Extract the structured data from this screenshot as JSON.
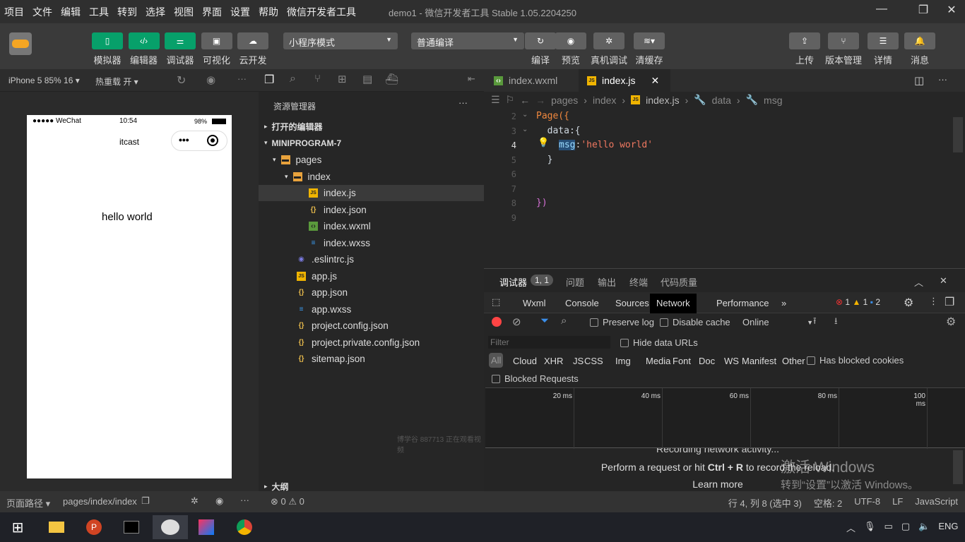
{
  "menu": [
    "项目",
    "文件",
    "编辑",
    "工具",
    "转到",
    "选择",
    "视图",
    "界面",
    "设置",
    "帮助",
    "微信开发者工具"
  ],
  "window_title": "demo1 - 微信开发者工具 Stable 1.05.2204250",
  "toolbar": {
    "left": [
      {
        "label": "模拟器",
        "icon": "phone-icon",
        "active": true
      },
      {
        "label": "编辑器",
        "icon": "code-icon",
        "active": true
      },
      {
        "label": "调试器",
        "icon": "debug-icon",
        "active": true
      },
      {
        "label": "可视化",
        "icon": "layout-icon",
        "active": false
      },
      {
        "label": "云开发",
        "icon": "cloud-icon",
        "active": false
      }
    ],
    "mode_select": "小程序模式",
    "compile_select": "普通编译",
    "middle": [
      {
        "label": "编译",
        "icon": "refresh-icon"
      },
      {
        "label": "预览",
        "icon": "eye-icon"
      },
      {
        "label": "真机调试",
        "icon": "bug-icon"
      },
      {
        "label": "清缓存",
        "icon": "layers-icon"
      }
    ],
    "right": [
      {
        "label": "上传",
        "icon": "upload-icon"
      },
      {
        "label": "版本管理",
        "icon": "branch-icon"
      },
      {
        "label": "详情",
        "icon": "menu-icon"
      },
      {
        "label": "消息",
        "icon": "bell-icon"
      }
    ]
  },
  "sim": {
    "device": "iPhone 5 85% 16 ▾",
    "hot_reload": "热重载 开 ▾",
    "carrier": "●●●●● WeChat",
    "time": "10:54",
    "battery": "98%",
    "nav_title": "itcast",
    "content": "hello world",
    "path_label": "页面路径 ▾",
    "path": "pages/index/index"
  },
  "explorer": {
    "title": "资源管理器",
    "open_editors": "打开的编辑器",
    "project": "MINIPROGRAM-7",
    "outline": "大纲",
    "files": [
      {
        "name": "pages",
        "indent": 1,
        "icon": "folder-icon",
        "tw": "▾"
      },
      {
        "name": "index",
        "indent": 2,
        "icon": "folder-icon",
        "tw": "▾"
      },
      {
        "name": "index.js",
        "indent": 3,
        "icon": "js-icon",
        "selected": true
      },
      {
        "name": "index.json",
        "indent": 3,
        "icon": "json-icon"
      },
      {
        "name": "index.wxml",
        "indent": 3,
        "icon": "wxml-icon"
      },
      {
        "name": "index.wxss",
        "indent": 3,
        "icon": "css-icon"
      },
      {
        "name": ".eslintrc.js",
        "indent": 2,
        "icon": "eslint-icon"
      },
      {
        "name": "app.js",
        "indent": 2,
        "icon": "js-icon"
      },
      {
        "name": "app.json",
        "indent": 2,
        "icon": "json-icon"
      },
      {
        "name": "app.wxss",
        "indent": 2,
        "icon": "css-icon"
      },
      {
        "name": "project.config.json",
        "indent": 2,
        "icon": "json-icon"
      },
      {
        "name": "project.private.config.json",
        "indent": 2,
        "icon": "json-icon"
      },
      {
        "name": "sitemap.json",
        "indent": 2,
        "icon": "json-icon"
      }
    ],
    "watermark": "博学谷 887713 正在观看视频"
  },
  "editor": {
    "tabs": [
      {
        "name": "index.wxml"
      },
      {
        "name": "index.js",
        "active": true
      }
    ],
    "breadcrumb": [
      "pages",
      "index",
      "index.js",
      "data",
      "msg"
    ],
    "lines": [
      {
        "n": "2",
        "t": "Page({"
      },
      {
        "n": "3",
        "t": "  data:{"
      },
      {
        "n": "4",
        "k": "msg",
        "v": "'hello world'"
      },
      {
        "n": "5",
        "t": "  }"
      },
      {
        "n": "6",
        "t": ""
      },
      {
        "n": "7",
        "t": ""
      },
      {
        "n": "8",
        "t": "})"
      },
      {
        "n": "9",
        "t": ""
      }
    ]
  },
  "debug": {
    "tabs": [
      "调试器",
      "问题",
      "输出",
      "终端",
      "代码质量"
    ],
    "badge": "1, 1",
    "devtabs": [
      "Wxml",
      "Console",
      "Sources",
      "Network",
      "Performance",
      "»"
    ],
    "errors": "1",
    "warnings": "1",
    "infos": "2",
    "preserve_log": "Preserve log",
    "disable_cache": "Disable cache",
    "throttle": "Online",
    "filter_placeholder": "Filter",
    "hide_data_urls": "Hide data URLs",
    "types": [
      "All",
      "Cloud",
      "XHR",
      "JS",
      "CSS",
      "Img",
      "Media",
      "Font",
      "Doc",
      "WS",
      "Manifest",
      "Other"
    ],
    "blocked_cookies": "Has blocked cookies",
    "blocked_requests": "Blocked Requests",
    "ticks": [
      "20 ms",
      "40 ms",
      "60 ms",
      "80 ms",
      "100 ms"
    ],
    "recording": "Recording network activity...",
    "hint_pre": "Perform a request or hit ",
    "hint_key": "Ctrl + R",
    "hint_post": " to record the reload.",
    "learn": "Learn more"
  },
  "activation": {
    "title": "激活 Windows",
    "sub": "转到“设置”以激活 Windows。"
  },
  "status": {
    "problems": "⊗ 0 ⚠ 0",
    "position": "行 4, 列 8 (选中 3)",
    "spaces": "空格: 2",
    "encoding": "UTF-8",
    "eol": "LF",
    "lang": "JavaScript"
  },
  "taskbar": {
    "lang": "ENG"
  }
}
